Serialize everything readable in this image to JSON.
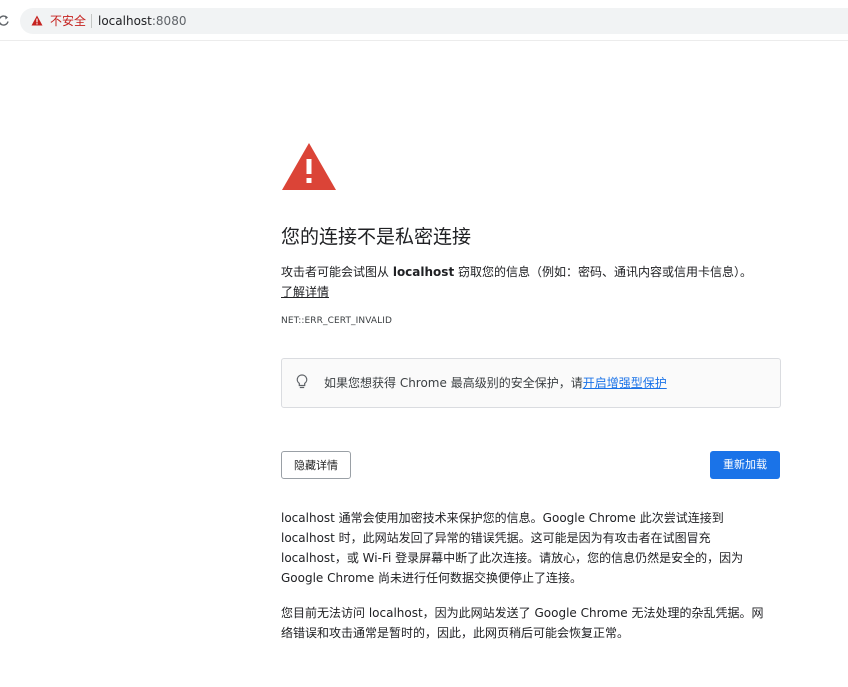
{
  "browser": {
    "security_label": "不安全",
    "url_host": "localhost",
    "url_port": ":8080"
  },
  "interstitial": {
    "title": "您的连接不是私密连接",
    "desc_prefix": "攻击者可能会试图从 ",
    "desc_host": "localhost",
    "desc_suffix": " 窃取您的信息（例如：密码、通讯内容或信用卡信息）。",
    "learn_more": "了解详情",
    "error_code": "NET::ERR_CERT_INVALID",
    "enhanced_prefix": "如果您想获得 Chrome 最高级别的安全保护，请",
    "enhanced_link": "开启增强型保护",
    "hide_details": "隐藏详情",
    "reload": "重新加载",
    "details_p1": [
      "localhost 通常会使用加密技术来保护您的信息。Google Chrome 此次尝试连接到",
      "localhost 时，此网站发回了异常的错误凭据。这可能是因为有攻击者在试图冒充",
      "localhost，或 Wi-Fi 登录屏幕中断了此次连接。请放心，您的信息仍然是安全的，因为",
      "Google Chrome 尚未进行任何数据交换便停止了连接。"
    ],
    "details_p2": [
      "您目前无法访问 localhost，因为此网站发送了 Google Chrome 无法处理的杂乱凭据。网",
      "络错误和攻击通常是暂时的，因此，此网页稍后可能会恢复正常。"
    ]
  },
  "colors": {
    "warning_red": "#db4437",
    "link_blue": "#1a73e8",
    "not_secure_red": "#c5221f"
  },
  "icons": [
    "reload-icon",
    "warning-icon",
    "lightbulb-icon"
  ]
}
